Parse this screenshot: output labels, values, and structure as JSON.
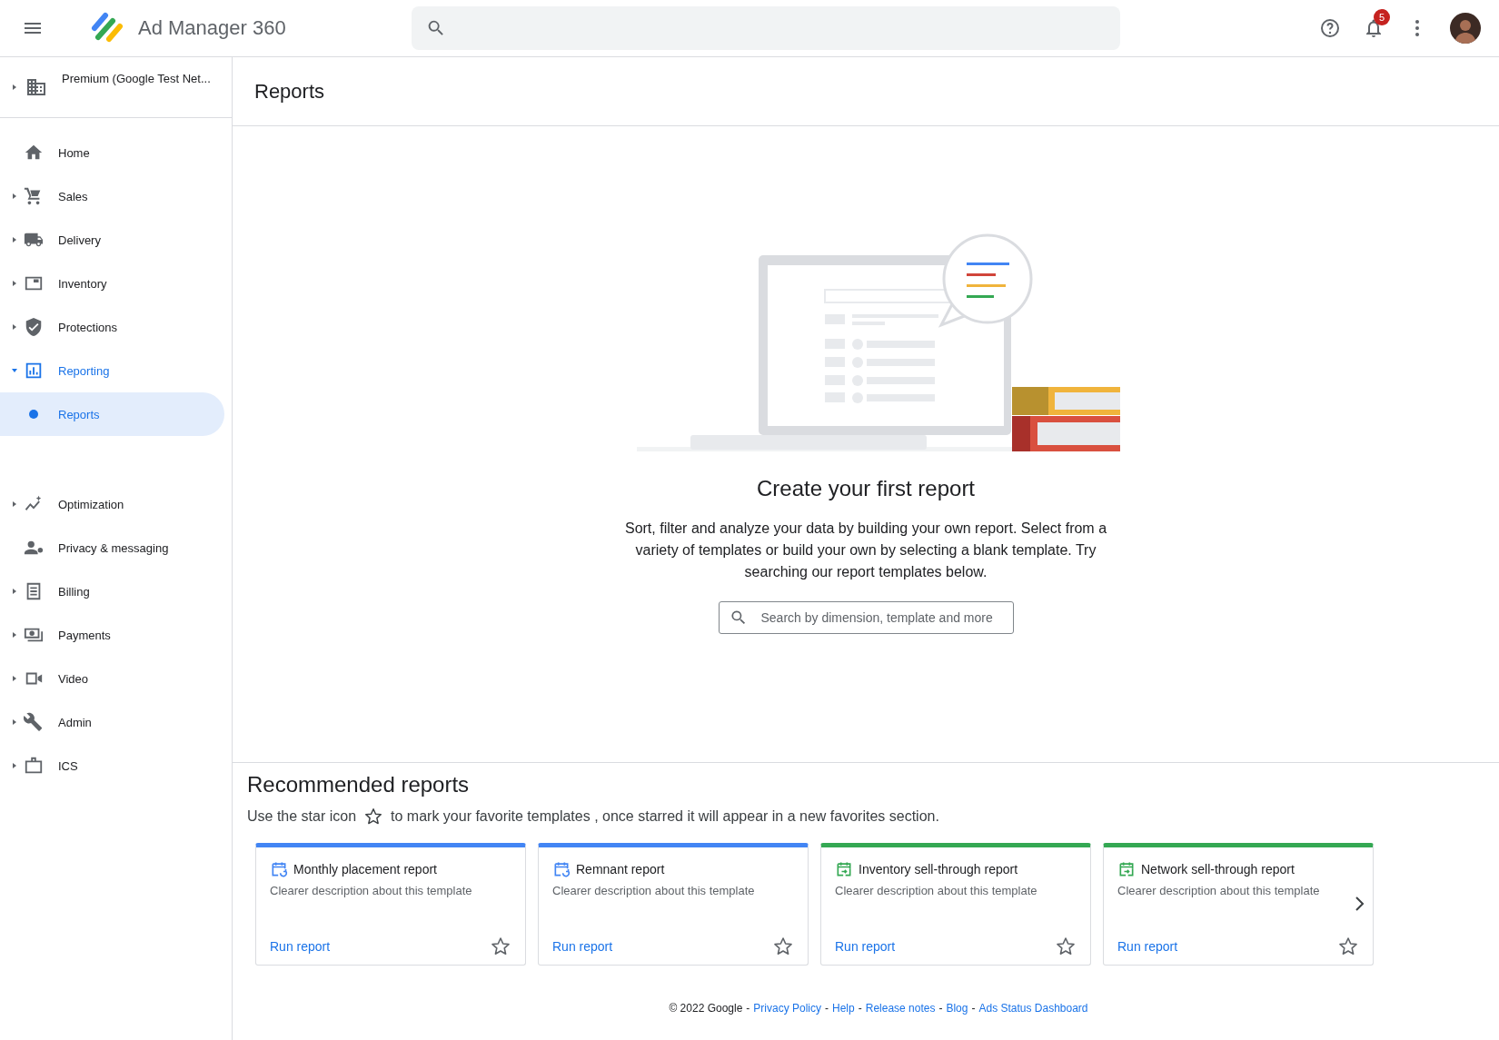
{
  "app_bar": {
    "title": "Ad Manager 360",
    "notification_count": "5"
  },
  "account": {
    "label": "Premium (Google Test Net..."
  },
  "sidebar": {
    "items": [
      {
        "label": "Home",
        "expandable": false,
        "expanded": false,
        "selected": false
      },
      {
        "label": "Sales",
        "expandable": true,
        "expanded": false,
        "selected": false
      },
      {
        "label": "Delivery",
        "expandable": true,
        "expanded": false,
        "selected": false
      },
      {
        "label": "Inventory",
        "expandable": true,
        "expanded": false,
        "selected": false
      },
      {
        "label": "Protections",
        "expandable": true,
        "expanded": false,
        "selected": false
      },
      {
        "label": "Reporting",
        "expandable": true,
        "expanded": true,
        "selected": false,
        "children": [
          {
            "label": "Reports",
            "selected": true
          }
        ]
      },
      {
        "label": "Optimization",
        "expandable": true,
        "expanded": false,
        "selected": false
      },
      {
        "label": "Privacy & messaging",
        "expandable": false,
        "expanded": false,
        "selected": false
      },
      {
        "label": "Billing",
        "expandable": true,
        "expanded": false,
        "selected": false
      },
      {
        "label": "Payments",
        "expandable": true,
        "expanded": false,
        "selected": false
      },
      {
        "label": "Video",
        "expandable": true,
        "expanded": false,
        "selected": false
      },
      {
        "label": "Admin",
        "expandable": true,
        "expanded": false,
        "selected": false
      },
      {
        "label": "ICS",
        "expandable": true,
        "expanded": false,
        "selected": false
      }
    ]
  },
  "page_title": "Reports",
  "empty_state": {
    "title": "Create your first report",
    "body": "Sort, filter and analyze your data by building your own report. Select from a variety of templates or build your own by selecting a blank template. Try searching our report templates below.",
    "search": {
      "placeholder": "Search by dimension, template and more"
    }
  },
  "recommended": {
    "title": "Recommended reports",
    "hint_before": "Use the star icon",
    "hint_after": "to mark your favorite templates , once starred it will appear in a new favorites section.",
    "cards": [
      {
        "kind": "scheduled",
        "color": "#4285f4",
        "title": "Monthly placement report",
        "description": "Clearer description about this template",
        "action": "Run report",
        "starred": false
      },
      {
        "kind": "scheduled",
        "color": "#4285f4",
        "title": "Remnant report",
        "description": "Clearer description about this template",
        "action": "Run report",
        "starred": false
      },
      {
        "kind": "sell-through",
        "color": "#34a853",
        "title": "Inventory sell-through report",
        "description": "Clearer description about this template",
        "action": "Run report",
        "starred": false
      },
      {
        "kind": "sell-through",
        "color": "#34a853",
        "title": "Network sell-through report",
        "description": "Clearer description about this template",
        "action": "Run report",
        "starred": false
      }
    ]
  },
  "footer": {
    "copyright": "© 2022 Google",
    "separator": "-",
    "links": [
      "Privacy Policy",
      "Help",
      "Release notes",
      "Blog",
      "Ads Status Dashboard"
    ]
  }
}
